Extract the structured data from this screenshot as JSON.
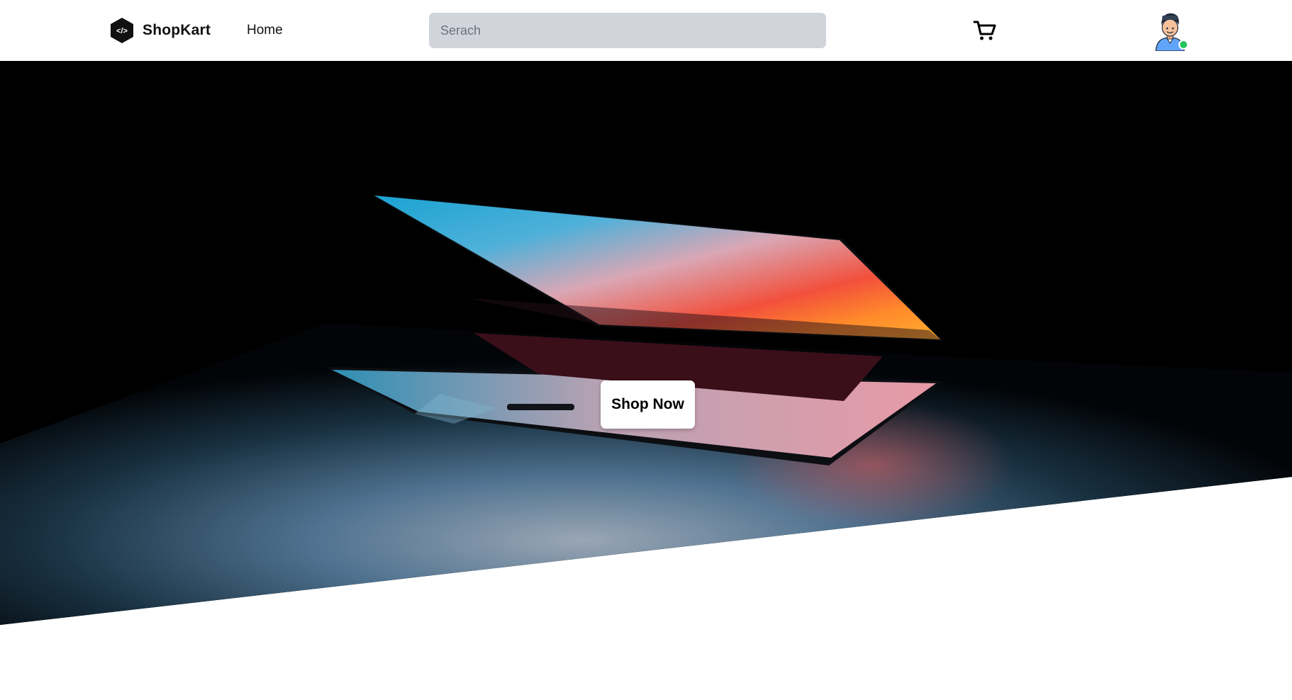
{
  "navbar": {
    "brand_name": "ShopKart",
    "home_label": "Home",
    "search_placeholder": "Serach",
    "cart_icon": "shopping-cart-icon",
    "avatar_icon": "user-avatar-icon",
    "status_color": "#22c55e"
  },
  "hero": {
    "cta_label": "Shop Now",
    "background_icon": "laptop-hero-image"
  },
  "colors": {
    "search_bg": "#d1d5db",
    "hero_bg": "#000000",
    "cta_bg": "#ffffff"
  }
}
